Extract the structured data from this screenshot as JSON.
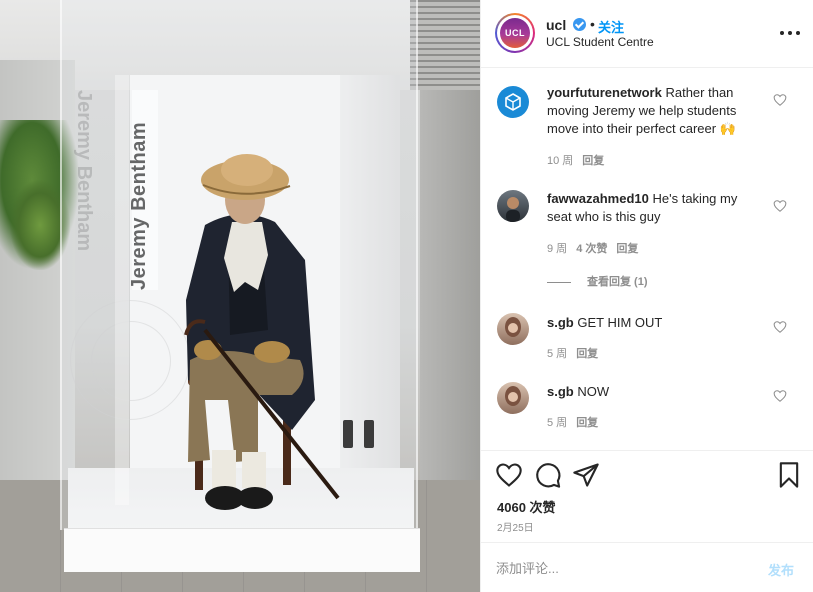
{
  "post": {
    "author": "ucl",
    "verified": true,
    "follow_label": "关注",
    "separator": "•",
    "location": "UCL Student Centre",
    "avatar_text": "UCL",
    "photo_caption_text": "Jeremy Bentham",
    "photo_caption_mirrored": "Jeremy Bentham"
  },
  "comments": [
    {
      "user": "yourfuturenetwork",
      "text": "Rather than moving Jeremy we help students move into their perfect career 🙌",
      "age": "10 周",
      "likes": "",
      "reply_label": "回复",
      "avatar_icon": "cube-logo-icon",
      "avatar_color": "#1a8ad6"
    },
    {
      "user": "fawwazahmed10",
      "text": "He's taking my seat who is this guy",
      "age": "9 周",
      "likes": "4 次赞",
      "reply_label": "回复",
      "avatar_icon": "user-photo-icon"
    },
    {
      "user": "s.gb",
      "text": "GET HIM OUT",
      "age": "5 周",
      "likes": "",
      "reply_label": "回复",
      "avatar_icon": "user-photo-icon"
    },
    {
      "user": "s.gb",
      "text": "NOW",
      "age": "5 周",
      "likes": "",
      "reply_label": "回复",
      "avatar_icon": "user-photo-icon"
    }
  ],
  "view_replies_label": "查看回复 (1)",
  "actions": {
    "like_icon": "heart-icon",
    "comment_icon": "comment-icon",
    "share_icon": "share-icon",
    "save_icon": "bookmark-icon"
  },
  "likes_count": "4060 次赞",
  "date": "2月25日",
  "add_comment": {
    "placeholder": "添加评论...",
    "post_label": "发布"
  },
  "colors": {
    "link": "#0095f6",
    "post_disabled": "#b2dffc",
    "muted": "#8e8e8e",
    "verified": "#3897f0"
  }
}
